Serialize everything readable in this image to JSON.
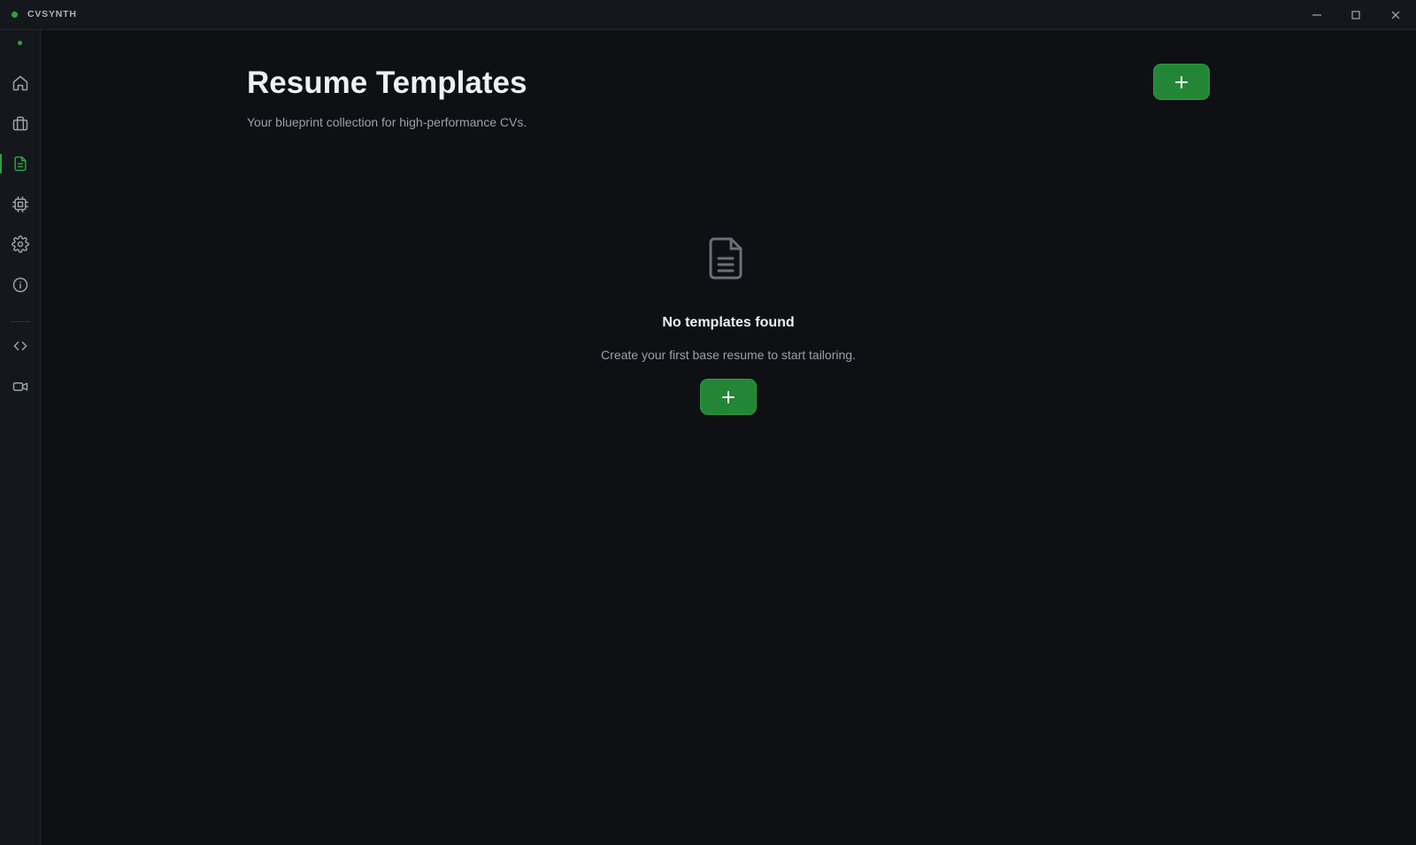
{
  "app": {
    "name": "CVSYNTH"
  },
  "window_controls": {
    "minimize_icon": "minimize-icon",
    "maximize_icon": "maximize-icon",
    "close_icon": "close-icon"
  },
  "sidebar": {
    "items": [
      {
        "icon": "home-icon",
        "active": false
      },
      {
        "icon": "briefcase-icon",
        "active": false
      },
      {
        "icon": "document-icon",
        "active": true
      },
      {
        "icon": "cpu-icon",
        "active": false
      },
      {
        "icon": "gear-icon",
        "active": false
      },
      {
        "icon": "info-icon",
        "active": false
      },
      {
        "icon": "code-icon",
        "active": false
      },
      {
        "icon": "video-icon",
        "active": false
      }
    ]
  },
  "header": {
    "title": "Resume Templates",
    "subtitle": "Your blueprint collection for high-performance CVs.",
    "add_button_icon": "plus-icon"
  },
  "empty_state": {
    "icon": "file-text-icon",
    "title": "No templates found",
    "description": "Create your first base resume to start tailoring.",
    "add_button_icon": "plus-icon"
  },
  "colors": {
    "accent": "#238636",
    "accent_indicator": "#2ea043",
    "background": "#0e1014",
    "panel": "#14171c"
  }
}
